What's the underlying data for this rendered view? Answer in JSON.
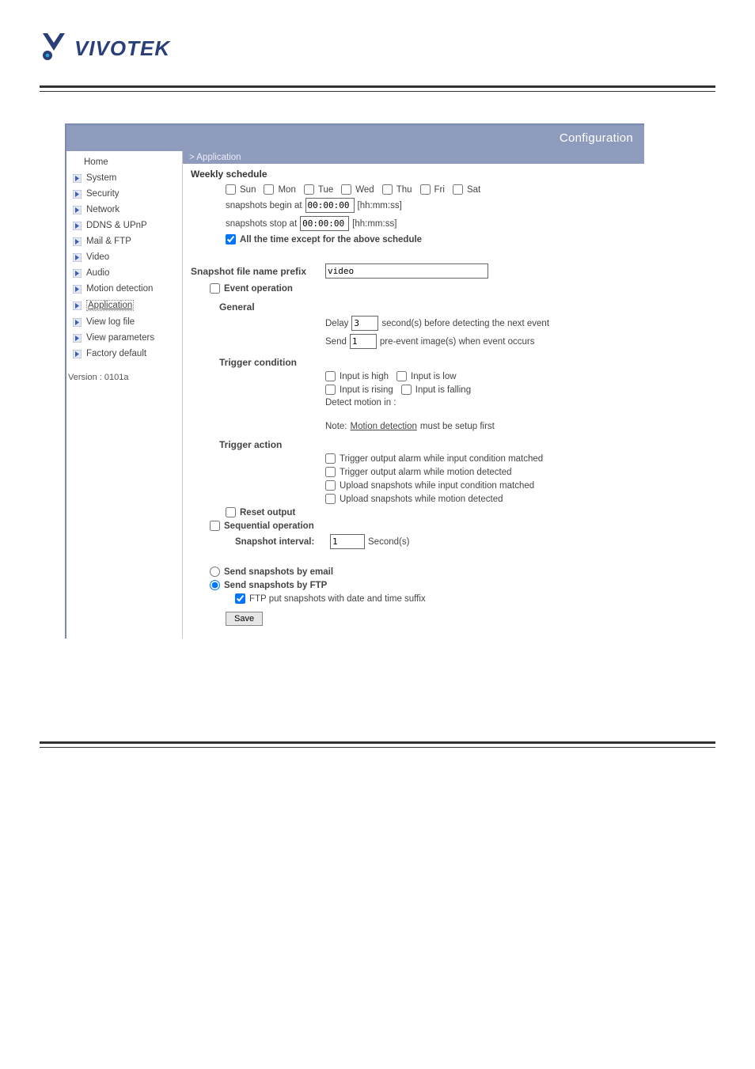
{
  "brand": {
    "name": "VIVOTEK"
  },
  "header": {
    "title": "Configuration"
  },
  "breadcrumb": "> Application",
  "sidebar": {
    "items": [
      {
        "label": "Home",
        "home": true
      },
      {
        "label": "System"
      },
      {
        "label": "Security"
      },
      {
        "label": "Network"
      },
      {
        "label": "DDNS & UPnP"
      },
      {
        "label": "Mail & FTP"
      },
      {
        "label": "Video"
      },
      {
        "label": "Audio"
      },
      {
        "label": "Motion detection"
      },
      {
        "label": "Application",
        "active": true
      },
      {
        "label": "View log file"
      },
      {
        "label": "View parameters"
      },
      {
        "label": "Factory default"
      }
    ],
    "version": "Version : 0101a"
  },
  "weekly": {
    "title": "Weekly schedule",
    "days": [
      "Sun",
      "Mon",
      "Tue",
      "Wed",
      "Thu",
      "Fri",
      "Sat"
    ],
    "begin_label": "snapshots begin at",
    "begin_value": "00:00:00",
    "stop_label": "snapshots stop at",
    "stop_value": "00:00:00",
    "time_hint": "[hh:mm:ss]",
    "except_label": "All the time except for the above schedule",
    "except_checked": true
  },
  "prefix": {
    "label": "Snapshot file name prefix",
    "value": "video"
  },
  "event": {
    "main_label": "Event operation",
    "main_checked": false,
    "general_label": "General",
    "delay_pre": "Delay",
    "delay_value": "3",
    "delay_post": "second(s) before detecting the next event",
    "send_pre": "Send",
    "send_value": "1",
    "send_post": "pre-event image(s) when event occurs",
    "trigger_cond_label": "Trigger condition",
    "input_high": "Input is high",
    "input_low": "Input is low",
    "input_rising": "Input is rising",
    "input_falling": "Input is falling",
    "detect_motion": "Detect motion in :",
    "note_pre": "Note: ",
    "note_link": "Motion detection",
    "note_post": " must be setup first",
    "trigger_action_label": "Trigger action",
    "actions": [
      "Trigger output alarm while input condition matched",
      "Trigger output alarm while motion detected",
      "Upload snapshots while input condition matched",
      "Upload snapshots while motion detected"
    ],
    "reset_output": "Reset output"
  },
  "sequential": {
    "main_label": "Sequential operation",
    "main_checked": false,
    "interval_label": "Snapshot interval:",
    "interval_value": "1",
    "interval_unit": "Second(s)"
  },
  "send": {
    "email_label": "Send snapshots by email",
    "ftp_label": "Send snapshots by FTP",
    "selected": "ftp",
    "ftp_suffix_label": "FTP put snapshots with date and time suffix",
    "ftp_suffix_checked": true
  },
  "save_label": "Save"
}
